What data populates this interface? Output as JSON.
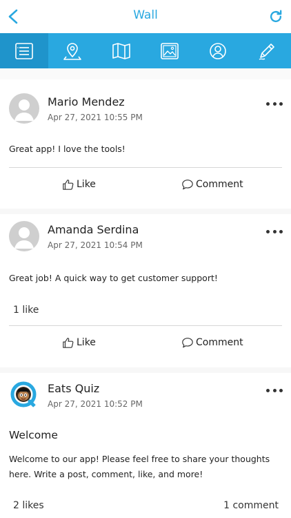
{
  "nav": {
    "title": "Wall"
  },
  "tabs": [
    {
      "icon": "list-icon"
    },
    {
      "icon": "map-pin-icon"
    },
    {
      "icon": "map-icon"
    },
    {
      "icon": "photo-icon"
    },
    {
      "icon": "globe-user-icon"
    },
    {
      "icon": "pen-icon"
    }
  ],
  "actions": {
    "like_label": "Like",
    "comment_label": "Comment"
  },
  "posts": [
    {
      "author": "Mario Mendez",
      "time": "Apr 27, 2021 10:55 PM",
      "text": "Great app! I love the tools!"
    },
    {
      "author": "Amanda Serdina",
      "time": "Apr 27, 2021 10:54 PM",
      "text": "Great job! A quick way to get customer support!",
      "likes": "1 like"
    },
    {
      "author": "Eats Quiz",
      "time": "Apr 27, 2021 10:52 PM",
      "title": "Welcome",
      "text": "Welcome to our app! Please feel free to share your thoughts here. Write a post, comment, like, and more!",
      "likes": "2 likes",
      "comments": "1 comment"
    }
  ],
  "colors": {
    "accent": "#29a8e0",
    "avatar_placeholder": "#cfcfcf"
  }
}
